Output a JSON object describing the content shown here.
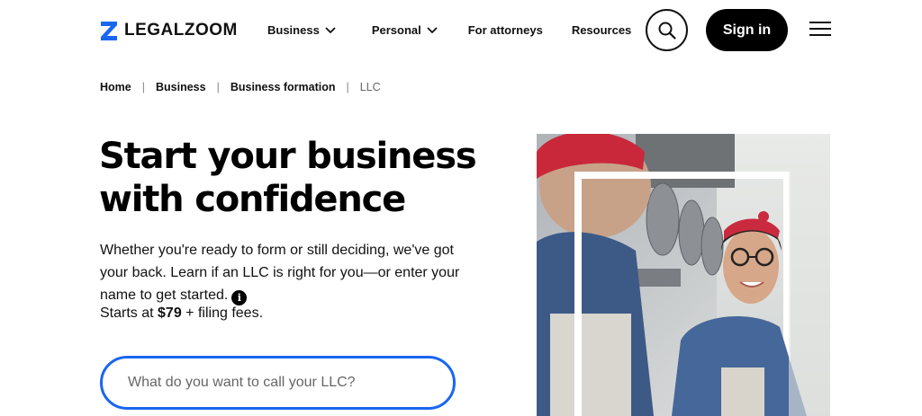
{
  "header": {
    "logo_text": "LEGALZOOM",
    "nav": [
      {
        "label": "Business",
        "has_dropdown": true
      },
      {
        "label": "Personal",
        "has_dropdown": true
      },
      {
        "label": "For attorneys",
        "has_dropdown": false
      },
      {
        "label": "Resources",
        "has_dropdown": false
      }
    ],
    "signin_label": "Sign in"
  },
  "breadcrumb": [
    "Home",
    "Business",
    "Business formation",
    "LLC"
  ],
  "hero": {
    "title_line1": "Start your business",
    "title_line2": "with confidence",
    "description": "Whether you're ready to form or still deciding, we've got your back. Learn if an LLC is right for you—or enter your name to get started.",
    "info_icon_glyph": "i",
    "price_prefix": "Starts at ",
    "price": "$79",
    "price_suffix": " + filing fees."
  },
  "search": {
    "placeholder": "What do you want to call your LLC?"
  },
  "colors": {
    "brand_blue": "#1a66f0",
    "primary_dark": "#000000"
  }
}
